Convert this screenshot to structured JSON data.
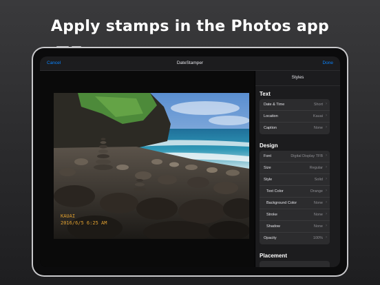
{
  "headline": "Apply stamps in the Photos app",
  "nav": {
    "cancel": "Cancel",
    "title": "DateStamper",
    "done": "Done"
  },
  "panel": {
    "title": "Styles",
    "sections": [
      {
        "heading": "Text",
        "rows": [
          {
            "label": "Date & Time",
            "value": "Short"
          },
          {
            "label": "Location",
            "value": "Kauai"
          },
          {
            "label": "Caption",
            "value": "None"
          }
        ]
      },
      {
        "heading": "Design",
        "rows": [
          {
            "label": "Font",
            "value": "Digital Display TFB"
          },
          {
            "label": "Size",
            "value": "Regular"
          },
          {
            "label": "Style",
            "value": "Solid"
          },
          {
            "label": "Text Color",
            "value": "Orange"
          },
          {
            "label": "Background Color",
            "value": "None"
          },
          {
            "label": "Stroke",
            "value": "None"
          },
          {
            "label": "Shadow",
            "value": "None"
          },
          {
            "label": "Opacity",
            "value": "100%"
          }
        ]
      },
      {
        "heading": "Placement",
        "rows": []
      }
    ]
  },
  "stamp": {
    "line1": "KAUAI",
    "line2": "2016/6/5 6:25 AM"
  },
  "colors": {
    "accent": "#0a84ff",
    "stamp": "#e0a030",
    "panel": "#1c1c1e",
    "cell": "#2c2c2e"
  }
}
